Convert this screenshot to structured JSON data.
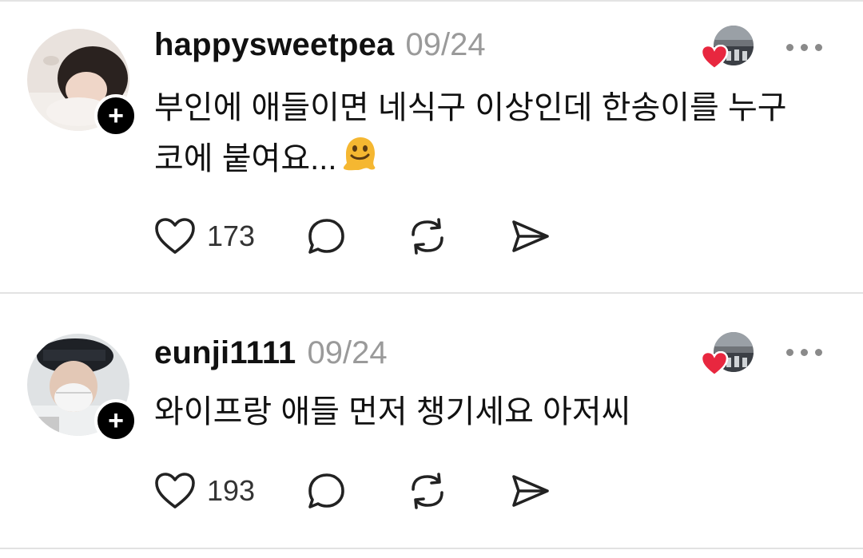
{
  "posts": [
    {
      "username": "happysweetpea",
      "date": "09/24",
      "text_line1": "부인에 애들이면 네식구 이상인데 한송이를 누구",
      "text_line2": "코에 붙여요...",
      "emoji": "melting-face-emoji",
      "like_count": "173",
      "follow_symbol": "+"
    },
    {
      "username": "eunji1111",
      "date": "09/24",
      "text_line1": "와이프랑 애들 먼저 챙기세요 아저씨",
      "like_count": "193",
      "follow_symbol": "+"
    }
  ],
  "icons": {
    "like": "heart-outline-icon",
    "comment": "comment-bubble-icon",
    "repost": "repost-arrows-icon",
    "share": "send-paper-plane-icon",
    "more": "more-dots-icon",
    "liked_by": "red-heart-icon"
  },
  "colors": {
    "heart_red": "#e8273f",
    "date_gray": "#9a9a9a",
    "divider": "#e2e2e2"
  }
}
